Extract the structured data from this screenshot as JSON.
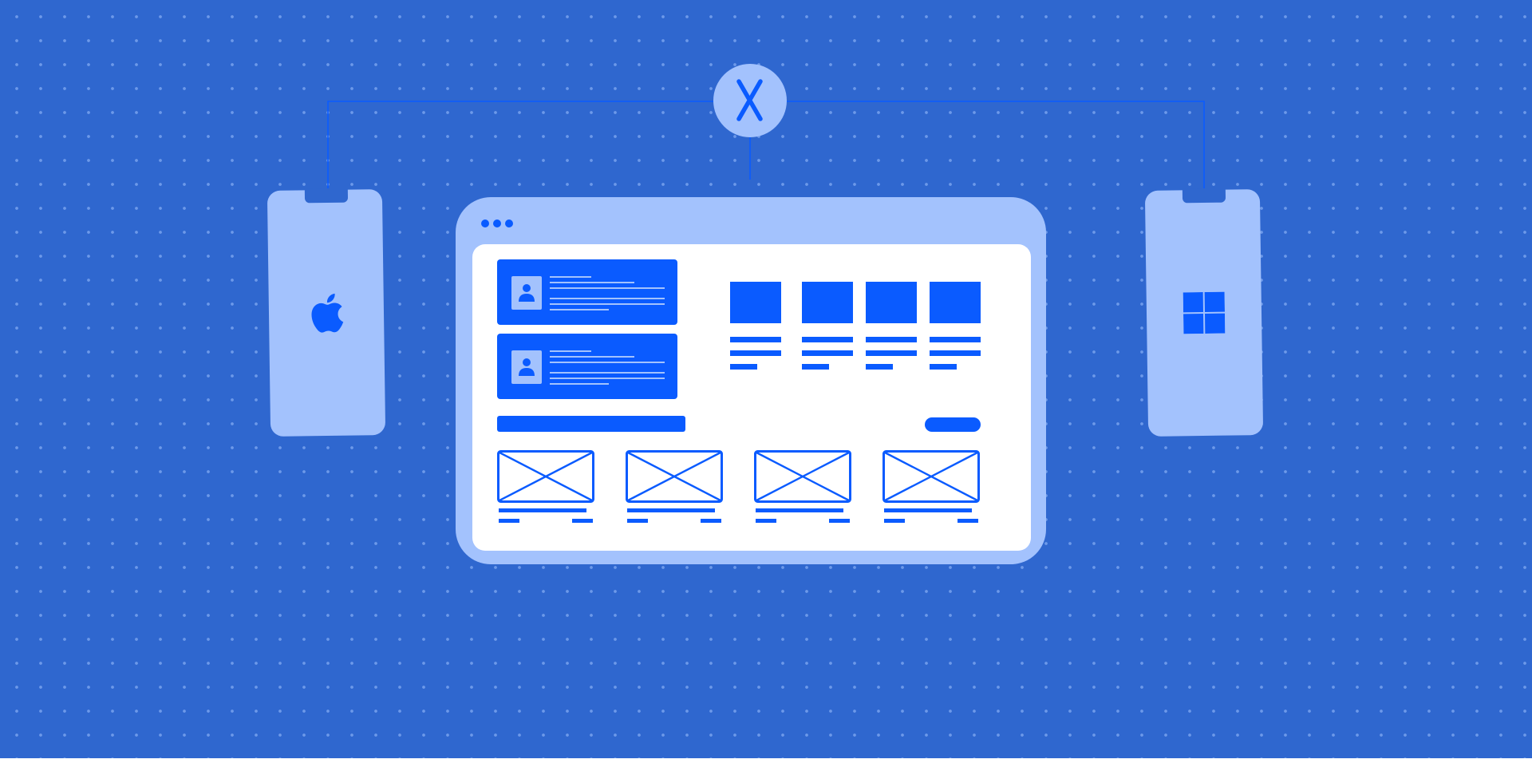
{
  "colors": {
    "background": "#2f67cf",
    "dot_grid": "#a0c3ff",
    "light_panel": "#a3c2fd",
    "accent": "#0a5bff",
    "content_bg": "#ffffff"
  },
  "icons": {
    "center_badge": "x-logo-icon",
    "left_phone": "apple-icon",
    "right_phone": "windows-icon"
  },
  "browser": {
    "window_controls": [
      "dot",
      "dot",
      "dot"
    ],
    "cards": [
      {
        "avatar": "user-icon",
        "text_lines": 6
      },
      {
        "avatar": "user-icon",
        "text_lines": 6
      }
    ],
    "product_tiles": 4,
    "image_placeholders": 4
  }
}
